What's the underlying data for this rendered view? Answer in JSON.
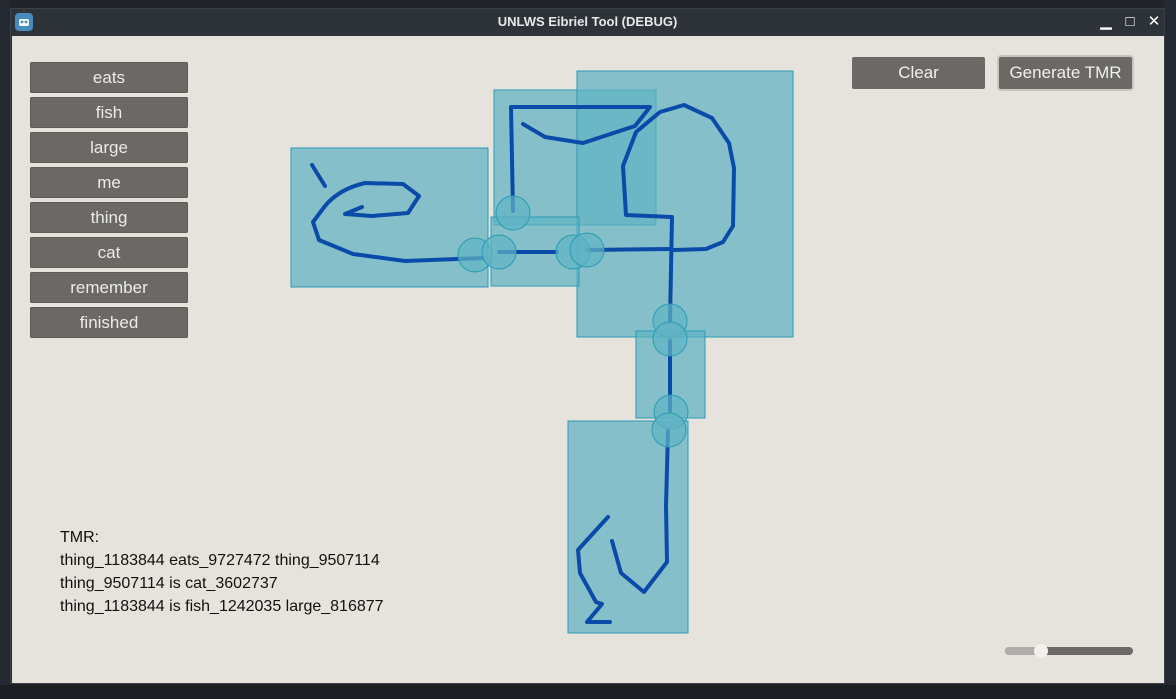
{
  "window": {
    "title": "UNLWS Eibriel Tool (DEBUG)"
  },
  "titlebar": {
    "minimize": "▁",
    "maximize": "□",
    "close": "✕"
  },
  "words": [
    "eats",
    "fish",
    "large",
    "me",
    "thing",
    "cat",
    "remember",
    "finished"
  ],
  "toolbar": {
    "clear_label": "Clear",
    "generate_label": "Generate TMR"
  },
  "tmr": {
    "heading": "TMR:",
    "lines": [
      "thing_1183844 eats_9727472 thing_9507114",
      "thing_9507114 is cat_3602737",
      "thing_1183844 is fish_1242035 large_816877"
    ]
  },
  "zoom": {
    "value": 0.28
  },
  "colors": {
    "panel": "#e6e2dc",
    "button": "#6b6966",
    "box_fill": "#5fb3c4",
    "box_stroke": "#2a9bb5",
    "stroke": "#0a4aa8"
  }
}
